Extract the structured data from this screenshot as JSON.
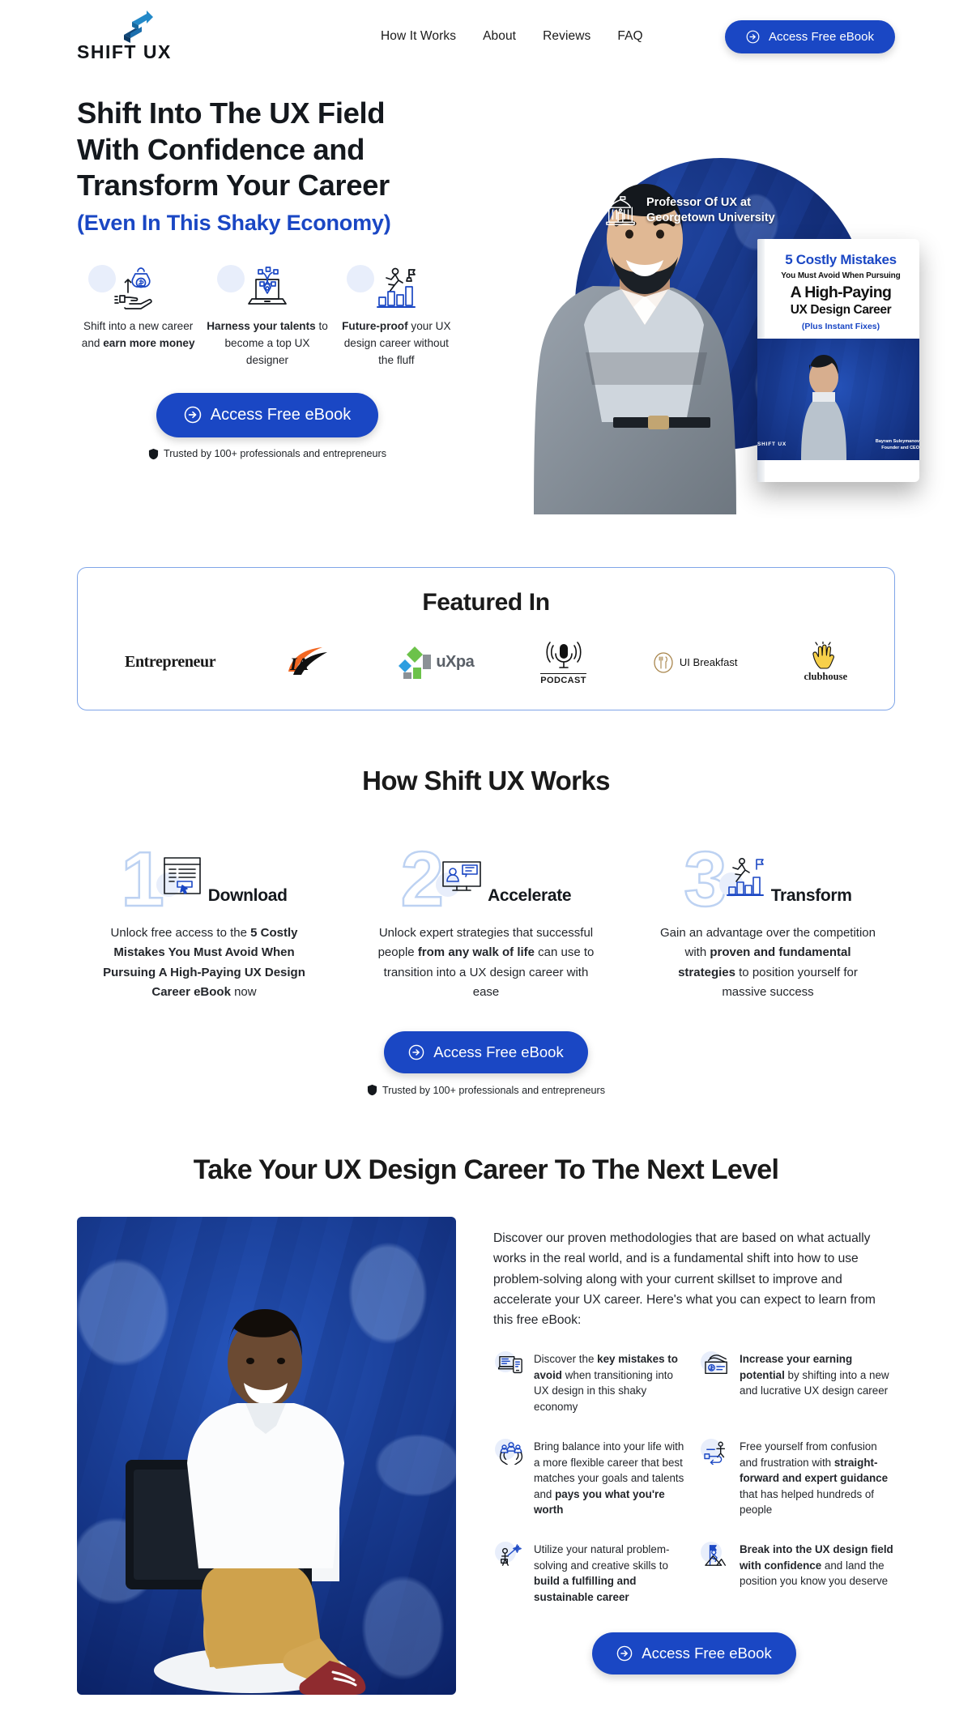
{
  "brand": {
    "name": "SHIFT UX",
    "logo_icon": "shift-arrow-logo",
    "accent_color": "#1a47c4",
    "text_color": "#14181d"
  },
  "header": {
    "nav": [
      {
        "label": "How It Works",
        "name": "nav-how-it-works"
      },
      {
        "label": "About",
        "name": "nav-about"
      },
      {
        "label": "Reviews",
        "name": "nav-reviews"
      },
      {
        "label": "FAQ",
        "name": "nav-faq"
      }
    ],
    "cta_label": "Access Free eBook"
  },
  "hero": {
    "heading_line1": "Shift Into The UX Field",
    "heading_line2": "With Confidence and",
    "heading_line3": "Transform Your Career",
    "subheading": "(Even In This Shaky Economy)",
    "features": [
      {
        "icon": "money-hand-icon",
        "pre": "Shift into a new career and ",
        "bold": "earn more money",
        "post": ""
      },
      {
        "icon": "laptop-pen-tool-icon",
        "pre": "",
        "bold": "Harness your talents",
        "post": " to become a top UX designer"
      },
      {
        "icon": "career-growth-icon",
        "pre": "",
        "bold": "Future-proof",
        "post": " your UX design career without the fluff"
      }
    ],
    "cta_label": "Access Free eBook",
    "trusted_text": "Trusted by 100+ professionals and entrepreneurs",
    "trusted_icon": "shield-icon",
    "badge": {
      "icon": "university-building-icon",
      "line1": "Professor Of UX at",
      "line2": "Georgetown University"
    },
    "ebook_cover": {
      "line1": "5 Costly Mistakes",
      "line2": "You Must Avoid When Pursuing",
      "line3": "A High-Paying",
      "line4": "UX Design Career",
      "line5": "(Plus Instant Fixes)",
      "logo": "SHIFT UX",
      "author_name": "Bayram Suleymanov",
      "author_title": "Founder and CEO"
    }
  },
  "featured": {
    "title": "Featured In",
    "logos": [
      {
        "name": "entrepreneur-logo",
        "label": "Entrepreneur"
      },
      {
        "name": "ia-logo",
        "label": "IA"
      },
      {
        "name": "uxpa-logo",
        "label": "uXpa"
      },
      {
        "name": "podcast-logo",
        "label": "PODCAST"
      },
      {
        "name": "ui-breakfast-logo",
        "label": "UI Breakfast"
      },
      {
        "name": "clubhouse-logo",
        "label": "clubhouse"
      }
    ]
  },
  "how_it_works": {
    "title": "How Shift UX Works",
    "steps": [
      {
        "number": "1",
        "label": "Download",
        "icon": "document-click-icon",
        "parts": [
          {
            "text": "Unlock free access to the ",
            "bold": false
          },
          {
            "text": "5 Costly Mistakes You Must Avoid When Pursuing A High-Paying UX Design Career eBook",
            "bold": true
          },
          {
            "text": " now",
            "bold": false
          }
        ]
      },
      {
        "number": "2",
        "label": "Accelerate",
        "icon": "monitor-user-chat-icon",
        "parts": [
          {
            "text": "Unlock expert strategies that successful people ",
            "bold": false
          },
          {
            "text": "from any walk of life",
            "bold": true
          },
          {
            "text": " can use to transition into a UX design career with ease",
            "bold": false
          }
        ]
      },
      {
        "number": "3",
        "label": "Transform",
        "icon": "stairs-goal-icon",
        "parts": [
          {
            "text": "Gain an advantage over the competition with ",
            "bold": false
          },
          {
            "text": "proven and fundamental strategies",
            "bold": true
          },
          {
            "text": " to position yourself for massive success",
            "bold": false
          }
        ]
      }
    ],
    "cta_label": "Access Free eBook",
    "trusted_text": "Trusted by 100+ professionals and entrepreneurs",
    "trusted_icon": "shield-icon"
  },
  "next_level": {
    "title": "Take Your UX Design Career To The Next Level",
    "paragraph": "Discover our proven methodologies that are based on what actually works in the real world, and is a fundamental shift into how to use problem-solving along with your current skillset to improve and accelerate your UX career. Here's what you can expect to learn from this free eBook:",
    "benefits": [
      {
        "icon": "laptop-mobile-icon",
        "parts": [
          {
            "text": "Discover the ",
            "bold": false
          },
          {
            "text": "key mistakes to avoid",
            "bold": true
          },
          {
            "text": " when transitioning into UX design in this shaky economy",
            "bold": false
          }
        ]
      },
      {
        "icon": "money-cash-icon",
        "parts": [
          {
            "text": "Increase your earning potential",
            "bold": true
          },
          {
            "text": " by shifting into a new and lucrative UX design career",
            "bold": false
          }
        ]
      },
      {
        "icon": "people-hands-icon",
        "parts": [
          {
            "text": "Bring balance into your life with a more flexible career that best matches your goals and talents and ",
            "bold": false
          },
          {
            "text": "pays you what you're worth",
            "bold": true
          }
        ]
      },
      {
        "icon": "flowchart-person-icon",
        "parts": [
          {
            "text": "Free yourself from confusion and frustration with ",
            "bold": false
          },
          {
            "text": "straight-forward and expert guidance",
            "bold": true
          },
          {
            "text": " that has helped hundreds of people",
            "bold": false
          }
        ]
      },
      {
        "icon": "person-magic-wand-icon",
        "parts": [
          {
            "text": "Utilize your natural problem-solving and creative skills to ",
            "bold": false
          },
          {
            "text": "build a fulfilling and sustainable career",
            "bold": true
          }
        ]
      },
      {
        "icon": "person-climb-flag-icon",
        "parts": [
          {
            "text": "Break into the UX design field with confidence",
            "bold": true
          },
          {
            "text": " and land the position you know you deserve",
            "bold": false
          }
        ]
      }
    ],
    "cta_label": "Access Free eBook"
  }
}
